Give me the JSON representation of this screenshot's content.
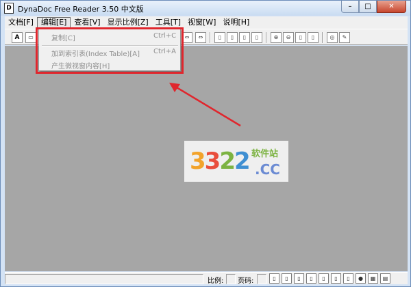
{
  "window": {
    "title": "DynaDoc Free Reader 3.50 中文版",
    "app_icon": "D"
  },
  "window_controls": {
    "minimize": "–",
    "maximize": "□",
    "close": "✕"
  },
  "menubar": {
    "items": [
      {
        "label": "文档[F]"
      },
      {
        "label": "编辑[E]"
      },
      {
        "label": "查看[V]"
      },
      {
        "label": "显示比例[Z]"
      },
      {
        "label": "工具[T]"
      },
      {
        "label": "视窗[W]"
      },
      {
        "label": "说明[H]"
      }
    ]
  },
  "toolbar": {
    "font_button": "A"
  },
  "edit_menu": {
    "items": [
      {
        "label": "复制[C]",
        "shortcut": "Ctrl+C",
        "enabled": false
      },
      {
        "label": "加到索引表(Index Table)[A]",
        "shortcut": "Ctrl+A",
        "enabled": false
      },
      {
        "label": "产生微视窗内容[H]",
        "shortcut": "",
        "enabled": false
      }
    ]
  },
  "watermark": {
    "digits": [
      "3",
      "3",
      "2",
      "2"
    ],
    "suffix": ".CC",
    "tagline": "软件站"
  },
  "statusbar": {
    "scale_label": "比例:",
    "page_label": "页码:"
  },
  "colors": {
    "highlight": "#e0262d",
    "arrow": "#e0262d",
    "client_bg": "#a6a6a6"
  }
}
